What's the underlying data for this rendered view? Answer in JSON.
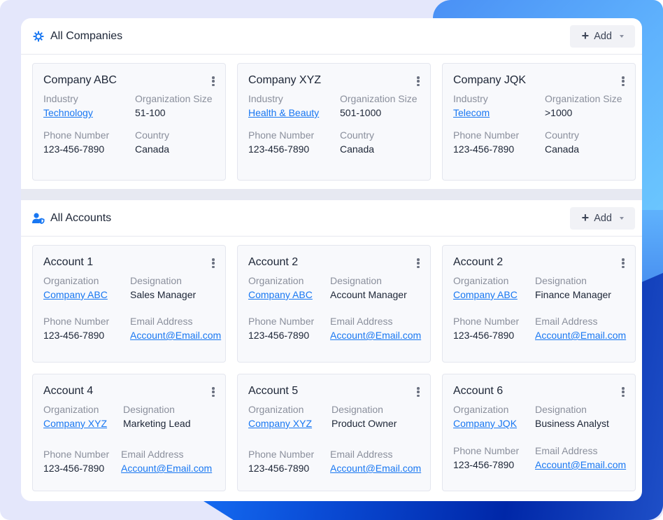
{
  "colors": {
    "accent": "#1877f2",
    "text_primary": "#1c2536",
    "text_secondary": "#8a8f9c",
    "card_bg": "#f8f9fc"
  },
  "companies_section": {
    "title": "All Companies",
    "icon": "gear-icon",
    "add_button": {
      "label": "Add",
      "icon": "plus-icon",
      "dropdown_icon": "caret-down-icon"
    },
    "cards": [
      {
        "name": "Company ABC",
        "menu_icon": "kebab-menu-icon",
        "fields": [
          {
            "label": "Industry",
            "value": "Technology",
            "link": true
          },
          {
            "label": "Organization Size",
            "value": "51-100",
            "link": false
          },
          {
            "label": "Phone Number",
            "value": "123-456-7890",
            "link": false
          },
          {
            "label": "Country",
            "value": "Canada",
            "link": false
          }
        ]
      },
      {
        "name": "Company XYZ",
        "menu_icon": "kebab-menu-icon",
        "fields": [
          {
            "label": "Industry",
            "value": "Health & Beauty",
            "link": true
          },
          {
            "label": "Organization Size",
            "value": "501-1000",
            "link": false
          },
          {
            "label": "Phone Number",
            "value": "123-456-7890",
            "link": false
          },
          {
            "label": "Country",
            "value": "Canada",
            "link": false
          }
        ]
      },
      {
        "name": "Company JQK",
        "menu_icon": "kebab-menu-icon",
        "fields": [
          {
            "label": "Industry",
            "value": "Telecom",
            "link": true
          },
          {
            "label": "Organization Size",
            "value": ">1000",
            "link": false
          },
          {
            "label": "Phone Number",
            "value": "123-456-7890",
            "link": false
          },
          {
            "label": "Country",
            "value": "Canada",
            "link": false
          }
        ]
      }
    ]
  },
  "accounts_section": {
    "title": "All Accounts",
    "icon": "user-shield-icon",
    "add_button": {
      "label": "Add",
      "icon": "plus-icon",
      "dropdown_icon": "caret-down-icon"
    },
    "cards": [
      {
        "name": "Account 1",
        "fields": [
          {
            "label": "Organization",
            "value": "Company ABC",
            "link": true
          },
          {
            "label": "Designation",
            "value": "Sales Manager",
            "link": false
          },
          {
            "label": "Phone Number",
            "value": "123-456-7890",
            "link": false
          },
          {
            "label": "Email Address",
            "value": "Account@Email.com",
            "link": true
          }
        ]
      },
      {
        "name": "Account 2",
        "fields": [
          {
            "label": "Organization",
            "value": "Company ABC",
            "link": true
          },
          {
            "label": "Designation",
            "value": "Account Manager",
            "link": false
          },
          {
            "label": "Phone Number",
            "value": "123-456-7890",
            "link": false
          },
          {
            "label": "Email Address",
            "value": "Account@Email.com",
            "link": true
          }
        ]
      },
      {
        "name": "Account 2",
        "fields": [
          {
            "label": "Organization",
            "value": "Company ABC",
            "link": true
          },
          {
            "label": "Designation",
            "value": "Finance Manager",
            "link": false
          },
          {
            "label": "Phone Number",
            "value": "123-456-7890",
            "link": false
          },
          {
            "label": "Email Address",
            "value": "Account@Email.com",
            "link": true
          }
        ]
      },
      {
        "name": "Account 4",
        "fields": [
          {
            "label": "Organization",
            "value": "Company XYZ",
            "link": true
          },
          {
            "label": "Designation",
            "value": "Marketing Lead",
            "link": false
          },
          {
            "label": "Phone Number",
            "value": "123-456-7890",
            "link": false
          },
          {
            "label": "Email Address",
            "value": "Account@Email.com",
            "link": true
          }
        ]
      },
      {
        "name": "Account 5",
        "fields": [
          {
            "label": "Organization",
            "value": "Company XYZ",
            "link": true
          },
          {
            "label": "Designation",
            "value": "Product Owner",
            "link": false
          },
          {
            "label": "Phone Number",
            "value": "123-456-7890",
            "link": false
          },
          {
            "label": "Email Address",
            "value": "Account@Email.com",
            "link": true
          }
        ]
      },
      {
        "name": "Account 6",
        "fields": [
          {
            "label": "Organization",
            "value": "Company JQK",
            "link": true
          },
          {
            "label": "Designation",
            "value": "Business Analyst",
            "link": false
          },
          {
            "label": "Phone Number",
            "value": "123-456-7890",
            "link": false
          },
          {
            "label": "Email Address",
            "value": "Account@Email.com",
            "link": true
          }
        ]
      }
    ]
  }
}
